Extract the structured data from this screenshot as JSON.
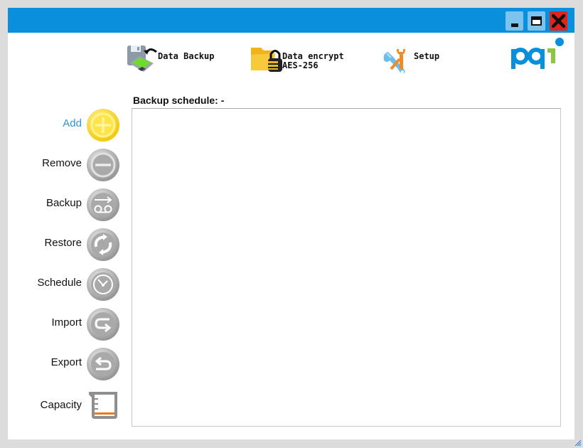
{
  "window": {
    "controls": {
      "minimize": "minimize",
      "maximize": "maximize",
      "close": "close"
    },
    "colors": {
      "titlebar": "#0a8fdc",
      "accent": "#2a96d8",
      "close": "#e0261c"
    }
  },
  "toolbar": {
    "items": [
      {
        "label": "Data Backup",
        "sublabel": "",
        "icon": "floppy-backup-icon"
      },
      {
        "label": "Data encrypt",
        "sublabel": "AES-256",
        "icon": "folder-lock-icon"
      },
      {
        "label": "Setup",
        "sublabel": "",
        "icon": "wrench-tools-icon"
      }
    ]
  },
  "logo": {
    "text": "pqi"
  },
  "main": {
    "schedule_label": "Backup schedule: -"
  },
  "sidebar": {
    "items": [
      {
        "label": "Add",
        "icon": "add-icon",
        "active": true
      },
      {
        "label": "Remove",
        "icon": "remove-icon"
      },
      {
        "label": "Backup",
        "icon": "backup-icon"
      },
      {
        "label": "Restore",
        "icon": "restore-icon"
      },
      {
        "label": "Schedule",
        "icon": "clock-icon"
      },
      {
        "label": "Import",
        "icon": "import-icon"
      },
      {
        "label": "Export",
        "icon": "export-icon"
      },
      {
        "label": "Capacity",
        "icon": "beaker-capacity-icon"
      }
    ]
  }
}
